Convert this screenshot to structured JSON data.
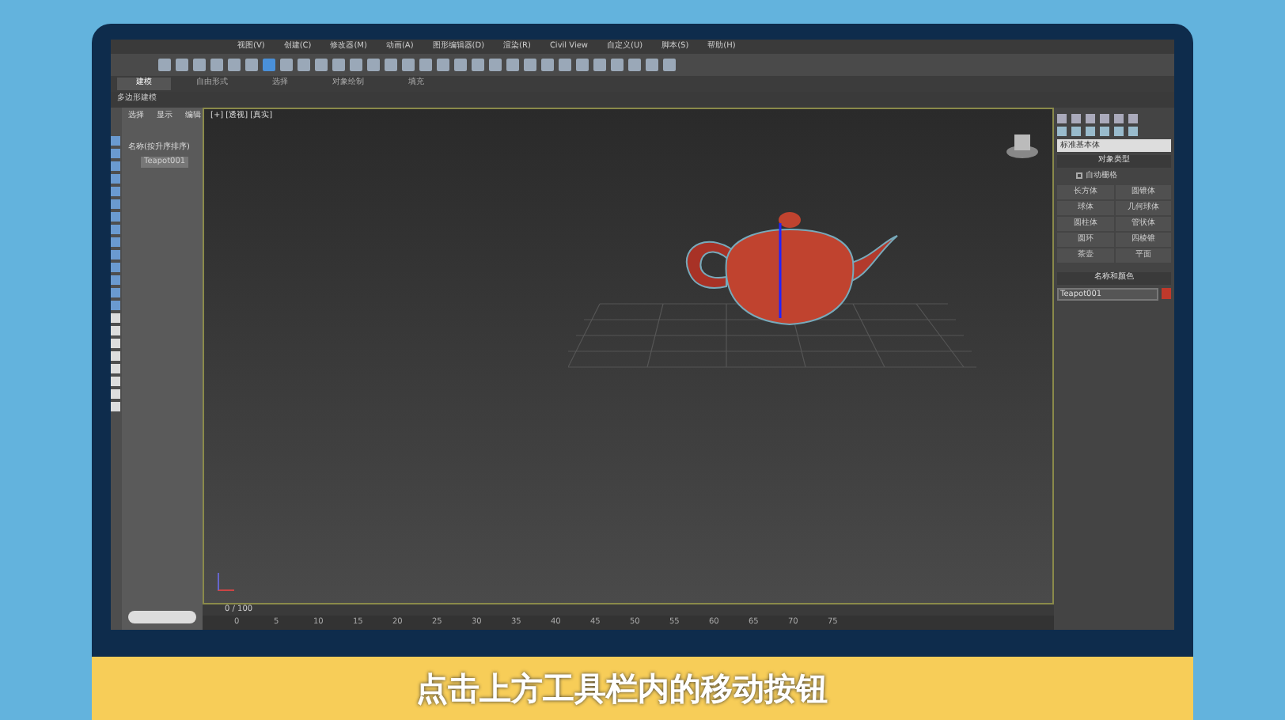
{
  "menu": [
    "视图(V)",
    "创建(C)",
    "修改器(M)",
    "动画(A)",
    "图形编辑器(D)",
    "渲染(R)",
    "Civil View",
    "自定义(U)",
    "脚本(S)",
    "帮助(H)"
  ],
  "ribbon_tabs": [
    {
      "label": "建模",
      "selected": true
    },
    {
      "label": "自由形式",
      "selected": false
    },
    {
      "label": "选择",
      "selected": false
    },
    {
      "label": "对象绘制",
      "selected": false
    },
    {
      "label": "填充",
      "selected": false
    }
  ],
  "ribbon_panel": "多边形建模",
  "explorer": {
    "tabs": [
      "选择",
      "显示",
      "编辑"
    ],
    "header": "名称(按升序排序)",
    "items": [
      {
        "label": "Teapot001",
        "selected": true
      }
    ]
  },
  "viewport": {
    "label": "[+] [透视] [真实]"
  },
  "command_panel": {
    "category": "标准基本体",
    "rollout_type": "对象类型",
    "autogrid": {
      "label": "自动栅格",
      "checked": false
    },
    "buttons": [
      "长方体",
      "圆锥体",
      "球体",
      "几何球体",
      "圆柱体",
      "管状体",
      "圆环",
      "四棱锥",
      "茶壶",
      "平面"
    ],
    "rollout_name": "名称和颜色",
    "object_name": "Teapot001",
    "color": "#c0392b"
  },
  "timeline": {
    "frame": "0 / 100",
    "ticks": [
      "0",
      "5",
      "10",
      "15",
      "20",
      "25",
      "30",
      "35",
      "40",
      "45",
      "50",
      "55",
      "60",
      "65",
      "70",
      "75"
    ]
  },
  "subtitle": "点击上方工具栏内的移动按钮"
}
